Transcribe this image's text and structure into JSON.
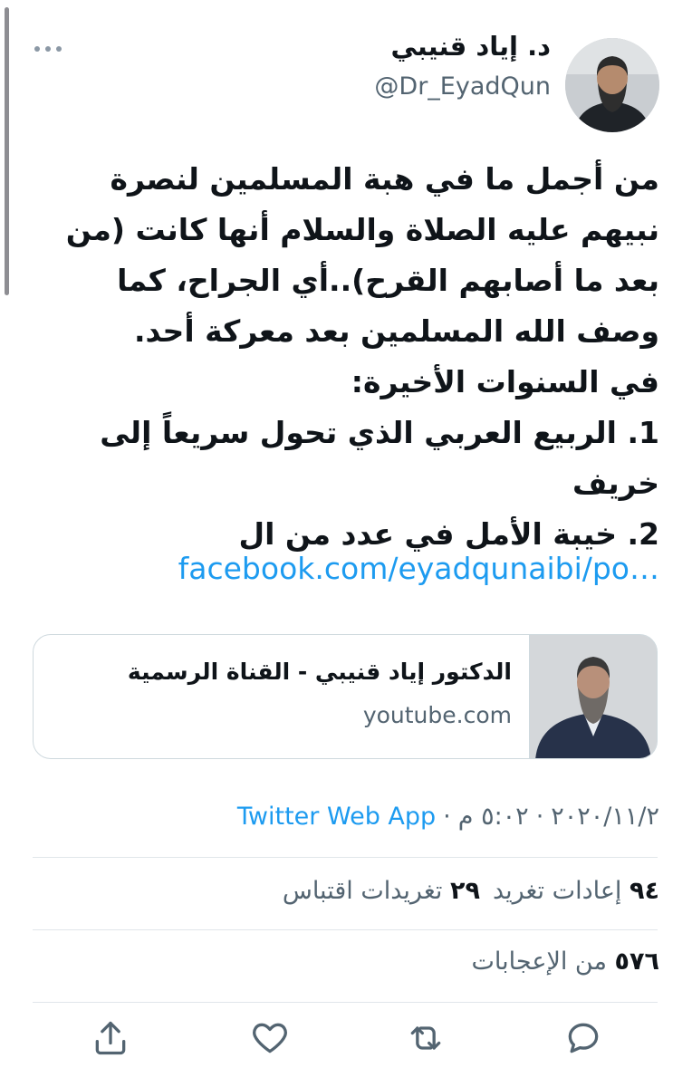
{
  "author": {
    "name": "د. إياد قنيبي",
    "handle": "@Dr_EyadQun"
  },
  "tweet": {
    "lines": [
      "من أجمل ما في هبة المسلمين لنصرة",
      "نبيهم عليه الصلاة والسلام أنها كانت (من",
      "بعد ما أصابهم القرح)..أي الجراح، كما",
      "وصف الله المسلمين بعد معركة أحد.",
      "في السنوات الأخيرة:",
      "1. الربيع العربي الذي تحول سريعاً إلى",
      "خريف",
      "2. خيبة الأمل في عدد من ال"
    ],
    "link": "facebook.com/eyadqunaibi/po…"
  },
  "card": {
    "title": "الدكتور إياد قنيبي - القناة الرسمية",
    "domain": "youtube.com"
  },
  "meta": {
    "date": "٢٠٢٠/١١/٢",
    "time": "٥:٠٢ م",
    "source": "Twitter Web App",
    "separator": "·"
  },
  "stats": {
    "retweets_count": "٩٤",
    "retweets_label": "إعادات تغريد",
    "quotes_count": "٢٩",
    "quotes_label": "تغريدات اقتباس",
    "likes_count": "٥٧٦",
    "likes_label": "من الإعجابات"
  },
  "icons": {
    "more": "more-icon",
    "reply": "reply-icon",
    "retweet": "retweet-icon",
    "like": "heart-icon",
    "share": "share-icon"
  },
  "colors": {
    "link": "#1d9bf0",
    "text": "#0f1419",
    "muted": "#536471"
  }
}
